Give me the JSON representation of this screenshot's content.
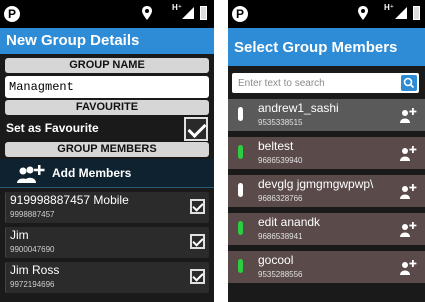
{
  "left": {
    "title": "New Group Details",
    "group_name_header": "GROUP NAME",
    "group_name_value": "Managment",
    "favourite_header": "FAVOURITE",
    "set_favourite_label": "Set as Favourite",
    "group_members_header": "GROUP MEMBERS",
    "add_members_label": "Add Members",
    "members": [
      {
        "name": "919998887457 Mobile",
        "phone": "9998887457",
        "checked": true
      },
      {
        "name": "Jim",
        "phone": "9900047690",
        "checked": true
      },
      {
        "name": "Jim Ross",
        "phone": "9972194696",
        "checked": true
      }
    ]
  },
  "right": {
    "title": "Select Group Members",
    "search_placeholder": "Enter text to search",
    "members": [
      {
        "name": "andrew1_sashi",
        "phone": "9535338515",
        "indicator": "white"
      },
      {
        "name": "beltest",
        "phone": "9686539940",
        "indicator": "green"
      },
      {
        "name": "devglg jgmgmgwpwp\\",
        "phone": "9686328766",
        "indicator": "white"
      },
      {
        "name": "edit anandk",
        "phone": "9686538941",
        "indicator": "green"
      },
      {
        "name": "gocool",
        "phone": "9535288556",
        "indicator": "green"
      }
    ]
  },
  "status_bar": {
    "network_label": "H⁺"
  },
  "colors": {
    "titlebar": "#2e8bd6",
    "accent_green": "#2ecc40"
  }
}
